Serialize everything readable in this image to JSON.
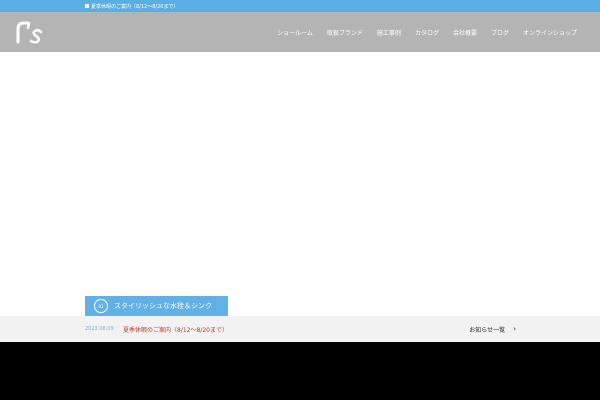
{
  "topbar": {
    "notice": "夏季休暇のご案内（8/12～8/20まで）"
  },
  "nav": {
    "items": [
      "ショールーム",
      "取扱ブランド",
      "施工事例",
      "カタログ",
      "会社概要",
      "ブログ",
      "オンラインショップ"
    ]
  },
  "hero": {
    "caption_number": "01",
    "caption_text": "スタイリッシュな水栓＆シンク"
  },
  "news": {
    "date": "2023.08.09",
    "title": "夏季休暇のご案内（8/12～8/20まで）",
    "all_link": "お知らせ一覧"
  },
  "colors": {
    "topbar": "#5aaee3",
    "header": "#b4b4b4",
    "accent_red": "#c0392b",
    "caption_blue": "#63b0e6"
  }
}
